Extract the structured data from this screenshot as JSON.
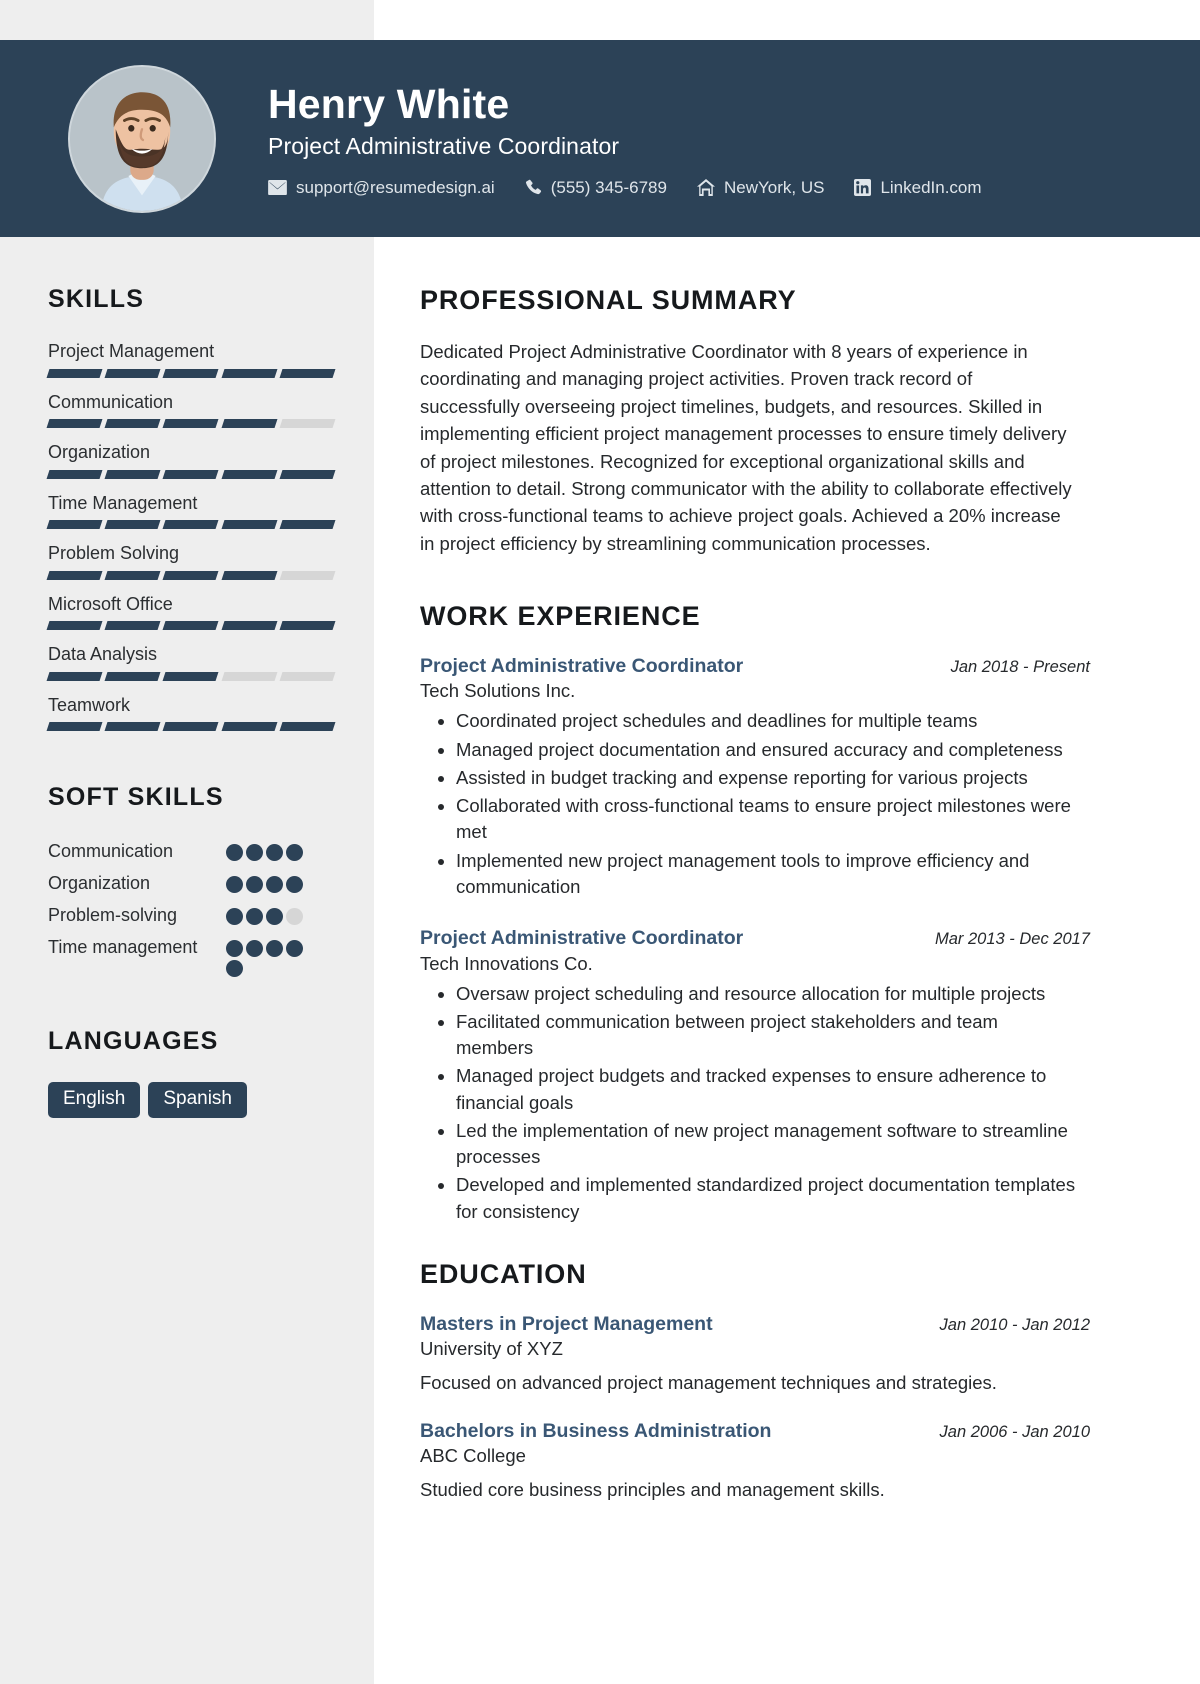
{
  "header": {
    "name": "Henry White",
    "job_title": "Project Administrative Coordinator",
    "contacts": [
      {
        "icon": "envelope-icon",
        "text": "support@resumedesign.ai"
      },
      {
        "icon": "phone-icon",
        "text": "(555) 345-6789"
      },
      {
        "icon": "home-icon",
        "text": "NewYork, US"
      },
      {
        "icon": "linkedin-icon",
        "text": "LinkedIn.com"
      }
    ],
    "background_color": "#2c4257",
    "avatar_alt": "profile-photo"
  },
  "sidebar": {
    "skills_heading": "SKILLS",
    "skills": [
      {
        "label": "Project Management",
        "level": 5,
        "max": 5
      },
      {
        "label": "Communication",
        "level": 4,
        "max": 5
      },
      {
        "label": "Organization",
        "level": 5,
        "max": 5
      },
      {
        "label": "Time Management",
        "level": 5,
        "max": 5
      },
      {
        "label": "Problem Solving",
        "level": 4,
        "max": 5
      },
      {
        "label": "Microsoft Office",
        "level": 5,
        "max": 5
      },
      {
        "label": "Data Analysis",
        "level": 3,
        "max": 5
      },
      {
        "label": "Teamwork",
        "level": 5,
        "max": 5
      }
    ],
    "soft_skills_heading": "SOFT SKILLS",
    "soft_skills": [
      {
        "label": "Communication",
        "level": 4,
        "max": 4
      },
      {
        "label": "Organization",
        "level": 4,
        "max": 4
      },
      {
        "label": "Problem-solving",
        "level": 3,
        "max": 4
      },
      {
        "label": "Time management",
        "level": 5,
        "max": 5
      }
    ],
    "languages_heading": "LANGUAGES",
    "languages": [
      "English",
      "Spanish"
    ],
    "accent_color": "#2c4257",
    "track_color": "#d6d6d6",
    "background_color": "#eeeeee"
  },
  "main": {
    "summary_heading": "PROFESSIONAL SUMMARY",
    "summary_text": "Dedicated Project Administrative Coordinator with 8 years of experience in coordinating and managing project activities. Proven track record of successfully overseeing project timelines, budgets, and resources. Skilled in implementing efficient project management processes to ensure timely delivery of project milestones. Recognized for exceptional organizational skills and attention to detail. Strong communicator with the ability to collaborate effectively with cross-functional teams to achieve project goals. Achieved a 20% increase in project efficiency by streamlining communication processes.",
    "experience_heading": "WORK EXPERIENCE",
    "experience": [
      {
        "title": "Project Administrative Coordinator",
        "company": "Tech Solutions Inc.",
        "date": "Jan 2018 - Present",
        "bullets": [
          "Coordinated project schedules and deadlines for multiple teams",
          "Managed project documentation and ensured accuracy and completeness",
          "Assisted in budget tracking and expense reporting for various projects",
          "Collaborated with cross-functional teams to ensure project milestones were met",
          "Implemented new project management tools to improve efficiency and communication"
        ]
      },
      {
        "title": "Project Administrative Coordinator",
        "company": "Tech Innovations Co.",
        "date": "Mar 2013 - Dec 2017",
        "bullets": [
          "Oversaw project scheduling and resource allocation for multiple projects",
          "Facilitated communication between project stakeholders and team members",
          "Managed project budgets and tracked expenses to ensure adherence to financial goals",
          "Led the implementation of new project management software to streamline processes",
          "Developed and implemented standardized project documentation templates for consistency"
        ]
      }
    ],
    "education_heading": "EDUCATION",
    "education": [
      {
        "degree": "Masters in Project Management",
        "school": "University of XYZ",
        "date": "Jan 2010 - Jan 2012",
        "description": "Focused on advanced project management techniques and strategies."
      },
      {
        "degree": "Bachelors in Business Administration",
        "school": "ABC College",
        "date": "Jan 2006 - Jan 2010",
        "description": "Studied core business principles and management skills."
      }
    ],
    "title_color": "#3a5775"
  }
}
